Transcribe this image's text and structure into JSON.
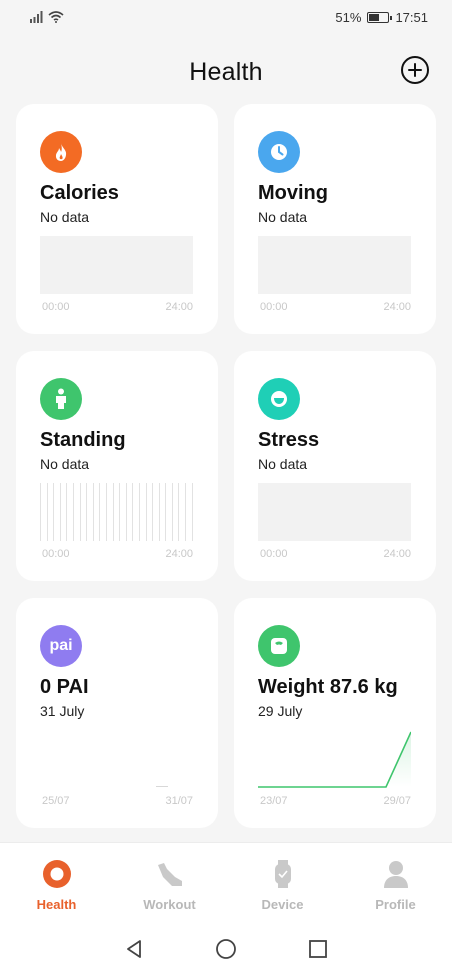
{
  "status": {
    "battery": "51%",
    "time": "17:51"
  },
  "header": {
    "title": "Health"
  },
  "cards": {
    "calories": {
      "title": "Calories",
      "sub": "No data",
      "axis_start": "00:00",
      "axis_end": "24:00",
      "color": "#f36b24"
    },
    "moving": {
      "title": "Moving",
      "sub": "No data",
      "axis_start": "00:00",
      "axis_end": "24:00",
      "color": "#4aa7ee"
    },
    "standing": {
      "title": "Standing",
      "sub": "No data",
      "axis_start": "00:00",
      "axis_end": "24:00",
      "color": "#3fc56d"
    },
    "stress": {
      "title": "Stress",
      "sub": "No data",
      "axis_start": "00:00",
      "axis_end": "24:00",
      "color": "#1fcfb6"
    },
    "pai": {
      "title": "0 PAI",
      "sub": "31 July",
      "icon_text": "pai",
      "axis_start": "25/07",
      "axis_end": "31/07",
      "color": "#8f7cf0"
    },
    "weight": {
      "title": "Weight 87.6 kg",
      "sub": "29 July",
      "axis_start": "23/07",
      "axis_end": "29/07",
      "color": "#3fc56d"
    }
  },
  "bottom_nav": {
    "items": [
      {
        "label": "Health",
        "active": true
      },
      {
        "label": "Workout",
        "active": false
      },
      {
        "label": "Device",
        "active": false
      },
      {
        "label": "Profile",
        "active": false
      }
    ]
  },
  "colors": {
    "accent": "#e8612c",
    "inactive": "#b8b8b8"
  }
}
